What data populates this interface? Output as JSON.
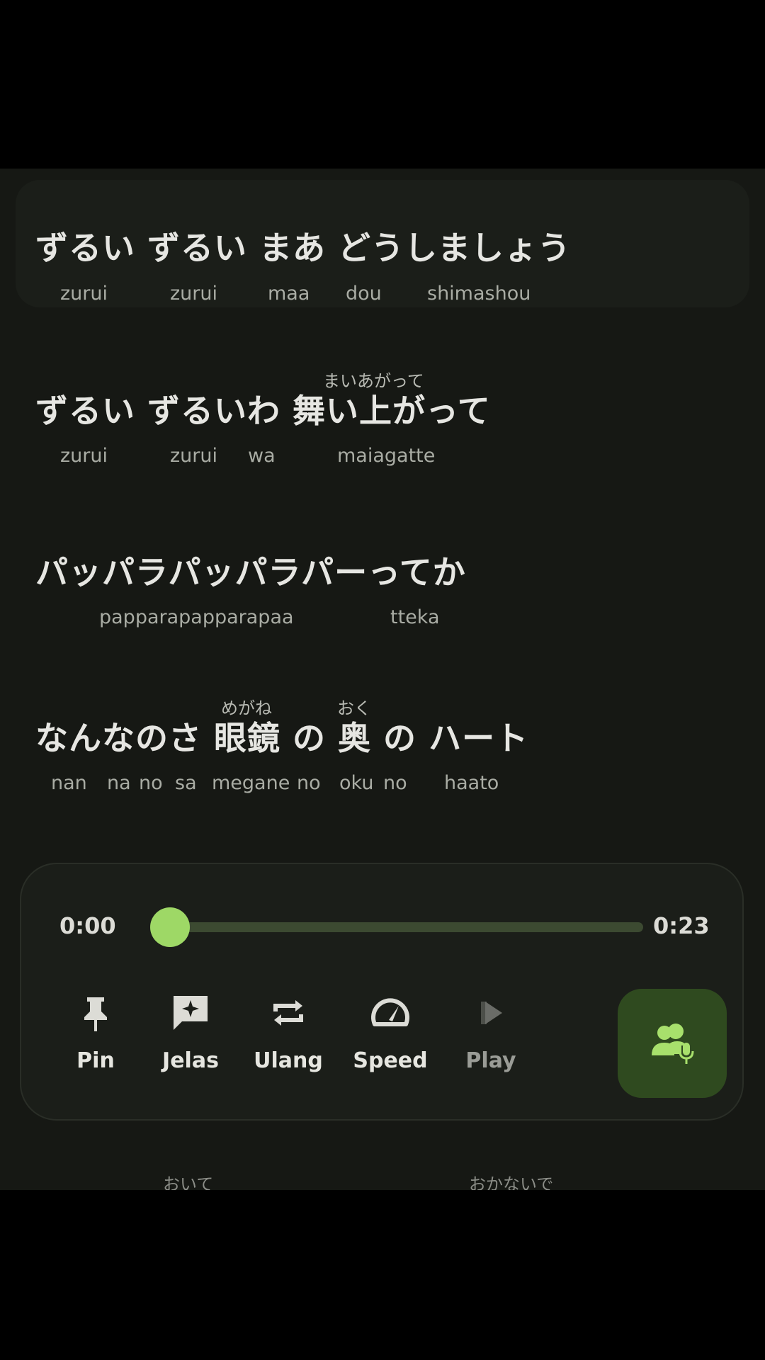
{
  "lyrics": [
    {
      "active": true,
      "text": "ずるい ずるい まあ どうしましょう",
      "words": [
        "zurui",
        "zurui",
        "maa",
        "dou",
        "shimashou"
      ]
    },
    {
      "active": false,
      "text": "ずるい ずるいわ 舞い上がって",
      "furigana": [
        "まいあがって"
      ],
      "words": [
        "zurui",
        "zurui",
        "wa",
        "maiagatte"
      ]
    },
    {
      "active": false,
      "text": "パッパラパッパラパーってか",
      "words": [
        "papparapapparapaa",
        "tteka"
      ]
    },
    {
      "active": false,
      "text": "なんなのさ 眼鏡 の 奥 の ハート",
      "furigana": [
        "めがね",
        "おく"
      ],
      "words": [
        "nan",
        "na",
        "no",
        "sa",
        "megane",
        "no",
        "oku",
        "no",
        "haato"
      ]
    }
  ],
  "player": {
    "current_time": "0:00",
    "total_time": "0:23",
    "progress": 0.0,
    "controls": [
      {
        "label": "Pin",
        "icon": "pin-icon"
      },
      {
        "label": "Jelas",
        "icon": "explain-icon"
      },
      {
        "label": "Ulang",
        "icon": "repeat-icon"
      },
      {
        "label": "Speed",
        "icon": "speed-icon"
      },
      {
        "label": "Play",
        "icon": "play-icon"
      }
    ],
    "mic_button_icon": "group-mic-icon"
  },
  "cutoff_text": [
    "おいて",
    "おかないで"
  ],
  "colors": {
    "accent": "#9ed866",
    "mic_bg": "#2f4a1f",
    "track": "#3c4a31",
    "background": "#161814"
  }
}
